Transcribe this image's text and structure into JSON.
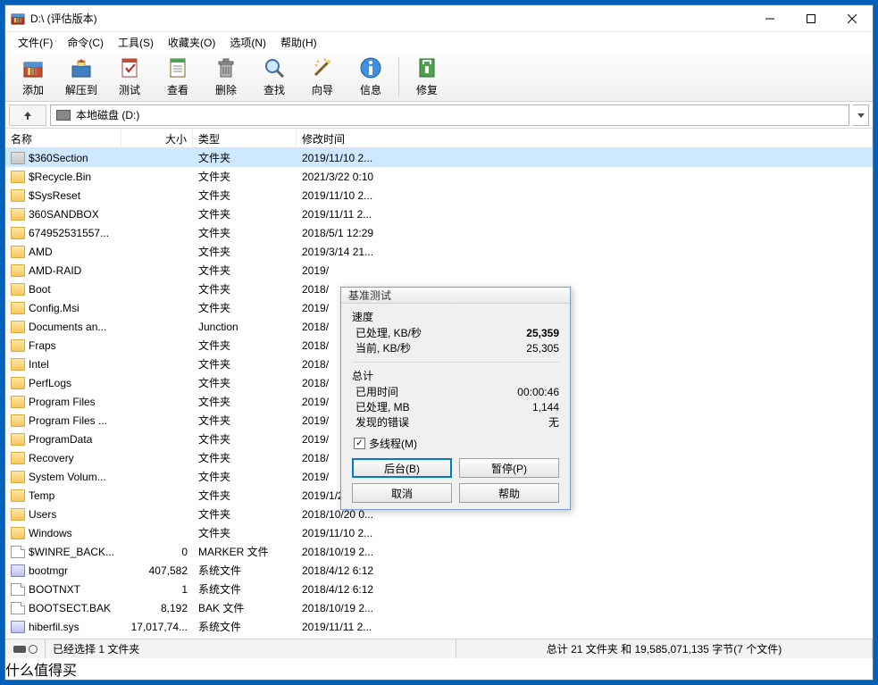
{
  "title": "D:\\ (评估版本)",
  "menu": [
    "文件(F)",
    "命令(C)",
    "工具(S)",
    "收藏夹(O)",
    "选项(N)",
    "帮助(H)"
  ],
  "toolbar": [
    {
      "id": "add",
      "label": "添加"
    },
    {
      "id": "extract",
      "label": "解压到"
    },
    {
      "id": "test",
      "label": "测试"
    },
    {
      "id": "view",
      "label": "查看"
    },
    {
      "id": "delete",
      "label": "删除"
    },
    {
      "id": "find",
      "label": "查找"
    },
    {
      "id": "wizard",
      "label": "向导"
    },
    {
      "id": "info",
      "label": "信息"
    },
    {
      "id": "repair",
      "label": "修复"
    }
  ],
  "path": "本地磁盘 (D:)",
  "columns": {
    "name": "名称",
    "size": "大小",
    "type": "类型",
    "date": "修改时间"
  },
  "rows": [
    {
      "icon": "folder-grey",
      "name": "$360Section",
      "size": "",
      "type": "文件夹",
      "date": "2019/11/10 2...",
      "sel": true
    },
    {
      "icon": "folder",
      "name": "$Recycle.Bin",
      "size": "",
      "type": "文件夹",
      "date": "2021/3/22 0:10"
    },
    {
      "icon": "folder",
      "name": "$SysReset",
      "size": "",
      "type": "文件夹",
      "date": "2019/11/10 2..."
    },
    {
      "icon": "folder",
      "name": "360SANDBOX",
      "size": "",
      "type": "文件夹",
      "date": "2019/11/11 2..."
    },
    {
      "icon": "folder",
      "name": "674952531557...",
      "size": "",
      "type": "文件夹",
      "date": "2018/5/1 12:29"
    },
    {
      "icon": "folder",
      "name": "AMD",
      "size": "",
      "type": "文件夹",
      "date": "2019/3/14 21..."
    },
    {
      "icon": "folder",
      "name": "AMD-RAID",
      "size": "",
      "type": "文件夹",
      "date": "2019/"
    },
    {
      "icon": "folder",
      "name": "Boot",
      "size": "",
      "type": "文件夹",
      "date": "2018/"
    },
    {
      "icon": "folder",
      "name": "Config.Msi",
      "size": "",
      "type": "文件夹",
      "date": "2019/"
    },
    {
      "icon": "folder",
      "name": "Documents an...",
      "size": "",
      "type": "Junction",
      "date": "2018/"
    },
    {
      "icon": "folder",
      "name": "Fraps",
      "size": "",
      "type": "文件夹",
      "date": "2018/"
    },
    {
      "icon": "folder",
      "name": "Intel",
      "size": "",
      "type": "文件夹",
      "date": "2018/"
    },
    {
      "icon": "folder",
      "name": "PerfLogs",
      "size": "",
      "type": "文件夹",
      "date": "2018/"
    },
    {
      "icon": "folder",
      "name": "Program Files",
      "size": "",
      "type": "文件夹",
      "date": "2019/"
    },
    {
      "icon": "folder",
      "name": "Program Files ...",
      "size": "",
      "type": "文件夹",
      "date": "2019/"
    },
    {
      "icon": "folder",
      "name": "ProgramData",
      "size": "",
      "type": "文件夹",
      "date": "2019/"
    },
    {
      "icon": "folder",
      "name": "Recovery",
      "size": "",
      "type": "文件夹",
      "date": "2018/"
    },
    {
      "icon": "folder",
      "name": "System Volum...",
      "size": "",
      "type": "文件夹",
      "date": "2019/"
    },
    {
      "icon": "folder",
      "name": "Temp",
      "size": "",
      "type": "文件夹",
      "date": "2019/1/23 0:29"
    },
    {
      "icon": "folder",
      "name": "Users",
      "size": "",
      "type": "文件夹",
      "date": "2018/10/20 0..."
    },
    {
      "icon": "folder",
      "name": "Windows",
      "size": "",
      "type": "文件夹",
      "date": "2019/11/10 2..."
    },
    {
      "icon": "file",
      "name": "$WINRE_BACK...",
      "size": "0",
      "type": "MARKER 文件",
      "date": "2018/10/19 2..."
    },
    {
      "icon": "sys",
      "name": "bootmgr",
      "size": "407,582",
      "type": "系统文件",
      "date": "2018/4/12 6:12"
    },
    {
      "icon": "file",
      "name": "BOOTNXT",
      "size": "1",
      "type": "系统文件",
      "date": "2018/4/12 6:12"
    },
    {
      "icon": "file",
      "name": "BOOTSECT.BAK",
      "size": "8,192",
      "type": "BAK 文件",
      "date": "2018/10/19 2..."
    },
    {
      "icon": "sys",
      "name": "hiberfil.sys",
      "size": "17,017,74...",
      "type": "系统文件",
      "date": "2019/11/11 2..."
    }
  ],
  "status": {
    "selected": "已经选择 1 文件夹",
    "total": "总计 21 文件夹 和 19,585,071,135 字节(7 个文件)"
  },
  "dialog": {
    "title": "基准测试",
    "speed_hdr": "速度",
    "processed_kbs_label": "已处理, KB/秒",
    "processed_kbs_value": "25,359",
    "current_kbs_label": "当前, KB/秒",
    "current_kbs_value": "25,305",
    "total_hdr": "总计",
    "elapsed_label": "已用时间",
    "elapsed_value": "00:00:46",
    "processed_mb_label": "已处理, MB",
    "processed_mb_value": "1,144",
    "errors_label": "发现的错误",
    "errors_value": "无",
    "multithread_label": "多线程(M)",
    "btn_background": "后台(B)",
    "btn_pause": "暂停(P)",
    "btn_cancel": "取消",
    "btn_help": "帮助"
  },
  "watermark": "什么值得买"
}
